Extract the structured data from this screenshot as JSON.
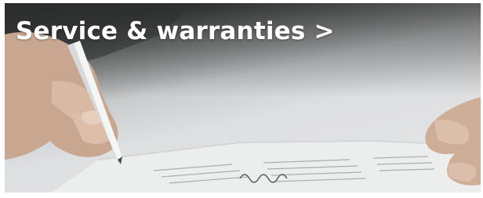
{
  "banner": {
    "title": "Service & warranties >"
  }
}
